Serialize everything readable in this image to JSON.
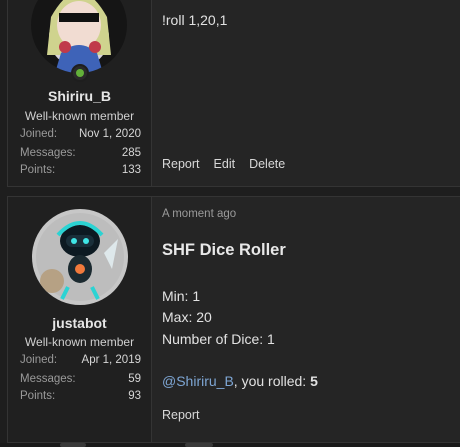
{
  "posts": [
    {
      "user": {
        "name": "Shiriru_B",
        "title": "Well-known member",
        "stats": [
          {
            "label": "Joined:",
            "value": "Nov 1, 2020"
          },
          {
            "label": "Messages:",
            "value": "285"
          },
          {
            "label": "Points:",
            "value": "133"
          }
        ],
        "online": true
      },
      "message": "!roll 1,20,1",
      "actions": [
        "Report",
        "Edit",
        "Delete"
      ]
    },
    {
      "user": {
        "name": "justabot",
        "title": "Well-known member",
        "stats": [
          {
            "label": "Joined:",
            "value": "Apr 1, 2019"
          },
          {
            "label": "Messages:",
            "value": "59"
          },
          {
            "label": "Points:",
            "value": "93"
          }
        ],
        "online": false
      },
      "time": "A moment ago",
      "dice": {
        "title": "SHF Dice Roller",
        "min": "Min: 1",
        "max": "Max: 20",
        "count": "Number of Dice: 1",
        "mention": "@Shiriru_B",
        "rolled_text": ", you rolled: ",
        "result": "5"
      },
      "actions": [
        "Report"
      ]
    }
  ],
  "colors": {
    "background": "#1e1e1e",
    "post_bg": "#252525",
    "user_col_bg": "#202020",
    "mention": "#7ea6d4",
    "online": "#63b03a"
  }
}
